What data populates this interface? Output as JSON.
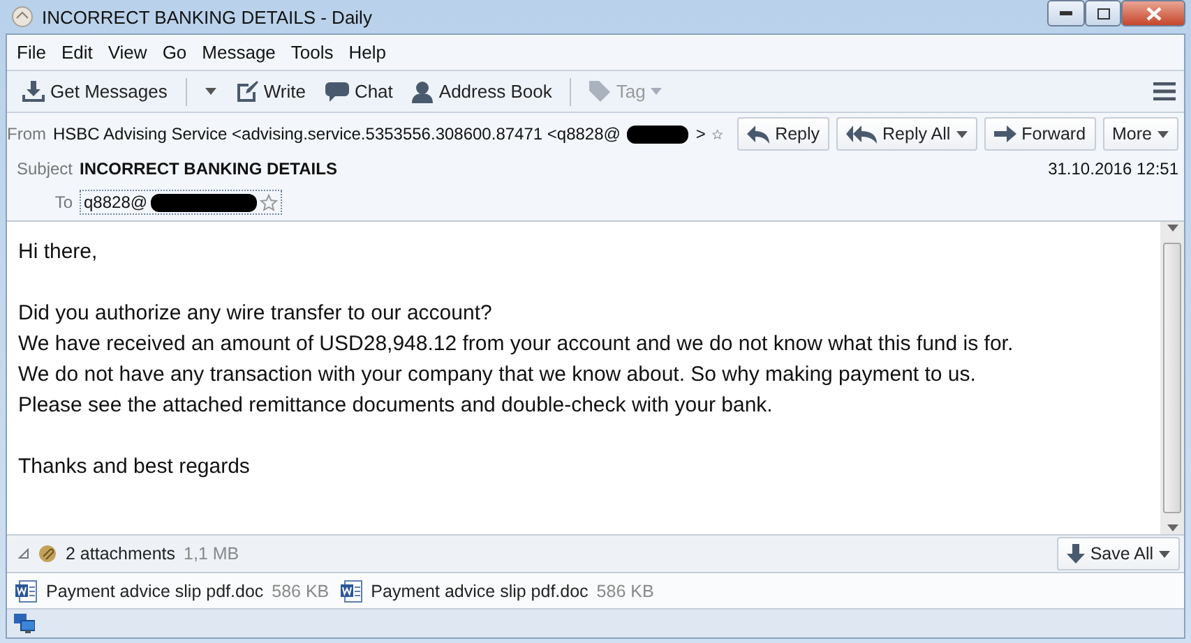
{
  "window": {
    "title": "INCORRECT BANKING DETAILS - Daily"
  },
  "menu": [
    "File",
    "Edit",
    "View",
    "Go",
    "Message",
    "Tools",
    "Help"
  ],
  "toolbar": [
    {
      "kind": "split",
      "label": "Get Messages",
      "disabled": false
    },
    {
      "kind": "plain",
      "label": "Write",
      "disabled": false
    },
    {
      "kind": "plain",
      "label": "Chat",
      "disabled": false
    },
    {
      "kind": "plain",
      "label": "Address Book",
      "disabled": false
    },
    {
      "kind": "dropdown",
      "label": "Tag",
      "disabled": true
    }
  ],
  "header": {
    "from_label": "From",
    "from": "HSBC Advising Service <advising.service.5353556.308600.87471 <q8828@",
    "from_tail": ">",
    "subject_label": "Subject",
    "subject": "INCORRECT BANKING DETAILS",
    "date": "31.10.2016 12:51",
    "to_label": "To",
    "to": "q8828@",
    "actions": [
      {
        "kind": "plain",
        "label": "Reply"
      },
      {
        "kind": "split",
        "label": "Reply All"
      },
      {
        "kind": "plain",
        "label": "Forward"
      },
      {
        "kind": "dropdown",
        "label": "More"
      }
    ]
  },
  "body": [
    [
      "Hi there,"
    ],
    [
      "Did you authorize any wire transfer to our account?",
      "We have received an amount of USD28,948.12 from your account and we do not know what this fund is for.",
      "We do not have any transaction with your company that we know about. So why making payment to us.",
      "Please see the attached remittance documents and double-check with your bank."
    ],
    [
      "Thanks and best regards"
    ]
  ],
  "attachments": {
    "expanded": true,
    "count": "2 attachments",
    "size": "1,1 MB",
    "save": "Save All",
    "files": [
      {
        "name": "Payment advice slip pdf.doc",
        "size": "586 KB"
      },
      {
        "name": "Payment advice slip pdf.doc",
        "size": "586 KB"
      }
    ]
  }
}
